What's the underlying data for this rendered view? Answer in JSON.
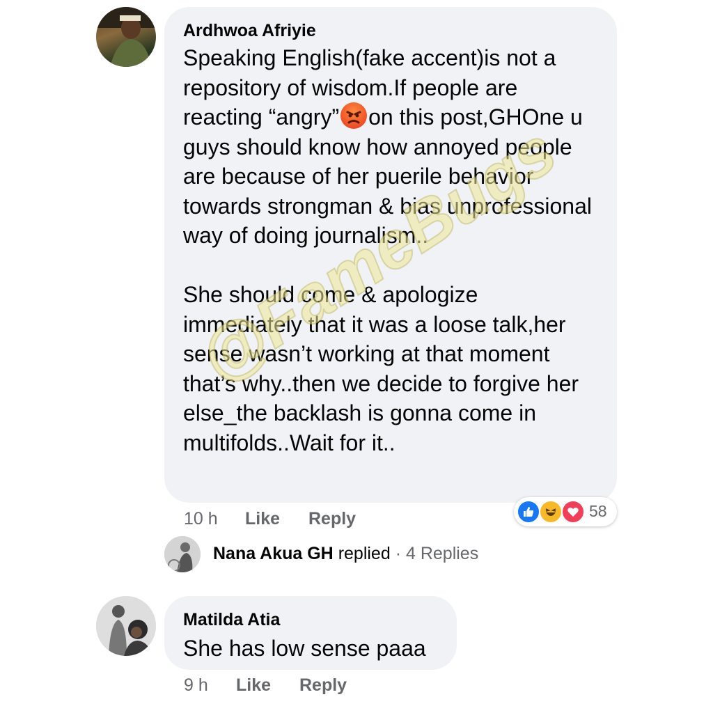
{
  "comments": [
    {
      "author": "Ardhwoa Afriyie",
      "text_before_emoji": "Speaking English(fake accent)is not a repository of wisdom.If people are reacting “angry”",
      "text_after_emoji": "on this post,GHOne u guys should know how annoyed people are because of her puerile behavior towards strongman & bias unprofessional way of doing journalism..\n\nShe should come & apologize immediately that it was a loose talk,her sense wasn’t working at that moment that’s why..then we decide to forgive her else_the backlash is gonna come in multifolds..Wait for it..",
      "inline_emoji": "angry-face-emoji",
      "time": "10 h",
      "like_label": "Like",
      "reply_label": "Reply",
      "reaction_icons": [
        "like-icon",
        "haha-icon",
        "love-icon"
      ],
      "reaction_count": "58",
      "replies_summary": {
        "name": "Nana Akua GH",
        "replied_label": "replied",
        "separator": "·",
        "count_label": "4 Replies"
      }
    },
    {
      "author": "Matilda Atia",
      "text": "She has low sense paaa",
      "time": "9 h",
      "like_label": "Like",
      "reply_label": "Reply"
    }
  ],
  "watermark": "@FameBugs",
  "colors": {
    "bubble": "#f0f2f5",
    "meta": "#65676b",
    "like_blue": "#1877f2",
    "love_red": "#f33e58",
    "haha_yellow": "#f7b928"
  }
}
